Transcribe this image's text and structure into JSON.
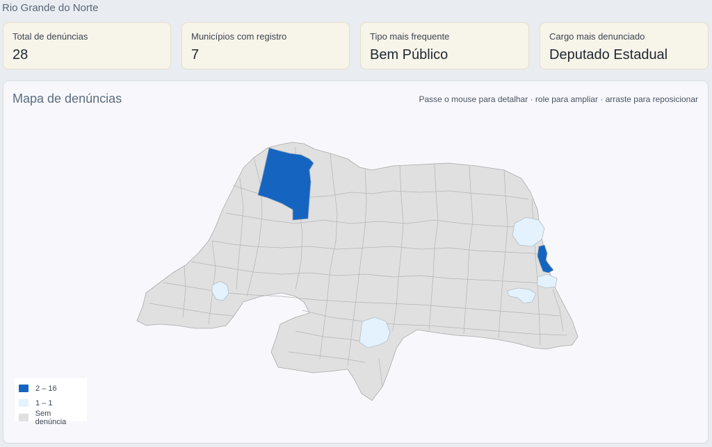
{
  "header": {
    "state": "Rio Grande do Norte"
  },
  "cards": [
    {
      "label": "Total de denúncias",
      "value": "28"
    },
    {
      "label": "Municípios com registro",
      "value": "7"
    },
    {
      "label": "Tipo mais frequente",
      "value": "Bem Público"
    },
    {
      "label": "Cargo mais denunciado",
      "value": "Deputado Estadual"
    }
  ],
  "map": {
    "title": "Mapa de denúncias",
    "hint": "Passe o mouse para detalhar · role para ampliar · arraste para reposicionar",
    "colors": {
      "high": "#1565c0",
      "low": "#e3f2fd",
      "none": "#e0e0e0",
      "border": "#9e9e9e"
    },
    "legend": [
      {
        "label": "2 – 16",
        "color": "#1565c0"
      },
      {
        "label": "1 – 1",
        "color": "#e3f2fd"
      },
      {
        "label": "Sem denúncia",
        "color": "#e0e0e0"
      }
    ]
  }
}
